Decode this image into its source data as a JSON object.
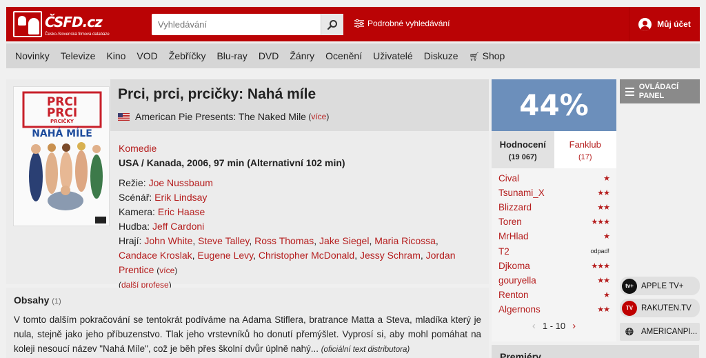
{
  "header": {
    "logo_text": "ČSFD",
    "logo_tld": ".cz",
    "logo_subtitle": "Česko-Slovenská filmová databáze",
    "search_placeholder": "Vyhledávání",
    "advanced_search": "Podrobné vyhledávání",
    "account": "Můj účet"
  },
  "nav": [
    "Novinky",
    "Televize",
    "Kino",
    "VOD",
    "Žebříčky",
    "Blu-ray",
    "DVD",
    "Žánry",
    "Ocenění",
    "Uživatelé",
    "Diskuze",
    "Shop"
  ],
  "film": {
    "poster_title": [
      "PRCI",
      "PRCI",
      "PRCIČKY",
      "NAHÁ MÍLE"
    ],
    "title": "Prci, prci, prcičky: Nahá míle",
    "original_title": "American Pie Presents: The Naked Mile",
    "more": "více",
    "genre": "Komedie",
    "origin": "USA / Kanada, 2006, 97 min (Alternativní 102 min)",
    "credits": {
      "directing_label": "Režie:",
      "director": "Joe Nussbaum",
      "screenplay_label": "Scénář:",
      "screenplay": "Erik Lindsay",
      "camera_label": "Kamera:",
      "camera": "Eric Haase",
      "music_label": "Hudba:",
      "music": "Jeff Cardoni",
      "cast_label": "Hrají:",
      "cast": [
        "John White",
        "Steve Talley",
        "Ross Thomas",
        "Jake Siegel",
        "Maria Ricossa",
        "Candace Kroslak",
        "Eugene Levy",
        "Christopher McDonald",
        "Jessy Schram",
        "Jordan Prentice"
      ],
      "more": "více",
      "more_professions": "další profese"
    }
  },
  "plot": {
    "heading": "Obsahy",
    "count": "(1)",
    "text": "V tomto dalším pokračování se tentokrát podíváme na Adama Stiflera, bratrance Matta a Steva, mladíka který je nula, stejně jako jeho příbuzenstvo. Tlak jeho vrstevníků ho donutí přemýšlet. Vyprosí si, aby mohl pomáhat na koleji nesoucí název \"Nahá Míle\", což je běh přes školní dvůr úplně nahý...",
    "source": "(oficiální text distributora)"
  },
  "rating": {
    "percent": "44%",
    "tab_ratings": "Hodnocení",
    "tab_ratings_count": "(19 067)",
    "tab_fanclub": "Fanklub",
    "tab_fanclub_count": "(17)",
    "users": [
      {
        "name": "Cival",
        "stars": "★",
        "rating": 1
      },
      {
        "name": "Tsunami_X",
        "stars": "★★",
        "rating": 2
      },
      {
        "name": "Blizzard",
        "stars": "★★",
        "rating": 2
      },
      {
        "name": "Toren",
        "stars": "★★★",
        "rating": 3
      },
      {
        "name": "MrHlad",
        "stars": "★",
        "rating": 1
      },
      {
        "name": "T2",
        "stars": "odpad!",
        "rating": 0
      },
      {
        "name": "Djkoma",
        "stars": "★★★",
        "rating": 3
      },
      {
        "name": "gouryella",
        "stars": "★★",
        "rating": 2
      },
      {
        "name": "Renton",
        "stars": "★",
        "rating": 1
      },
      {
        "name": "Algernons",
        "stars": "★★",
        "rating": 2
      }
    ],
    "pager": "1 - 10",
    "prev": "‹",
    "next": "›"
  },
  "sidebar": {
    "panel_label": "OVLÁDACÍ PANEL",
    "premiery": "Premiéry",
    "vod": [
      {
        "label": "APPLE TV+",
        "icon": "apple-tv-icon",
        "color": "#111111"
      },
      {
        "label": "RAKUTEN.TV",
        "icon": "rakuten-tv-icon",
        "color": "#bf0000"
      },
      {
        "label": "AMERICANPI...",
        "icon": "globe-icon",
        "color": "#222222"
      }
    ]
  },
  "colors": {
    "brand": "#ba0305",
    "rating": "#6c8fbb",
    "link": "#b51d1d"
  }
}
